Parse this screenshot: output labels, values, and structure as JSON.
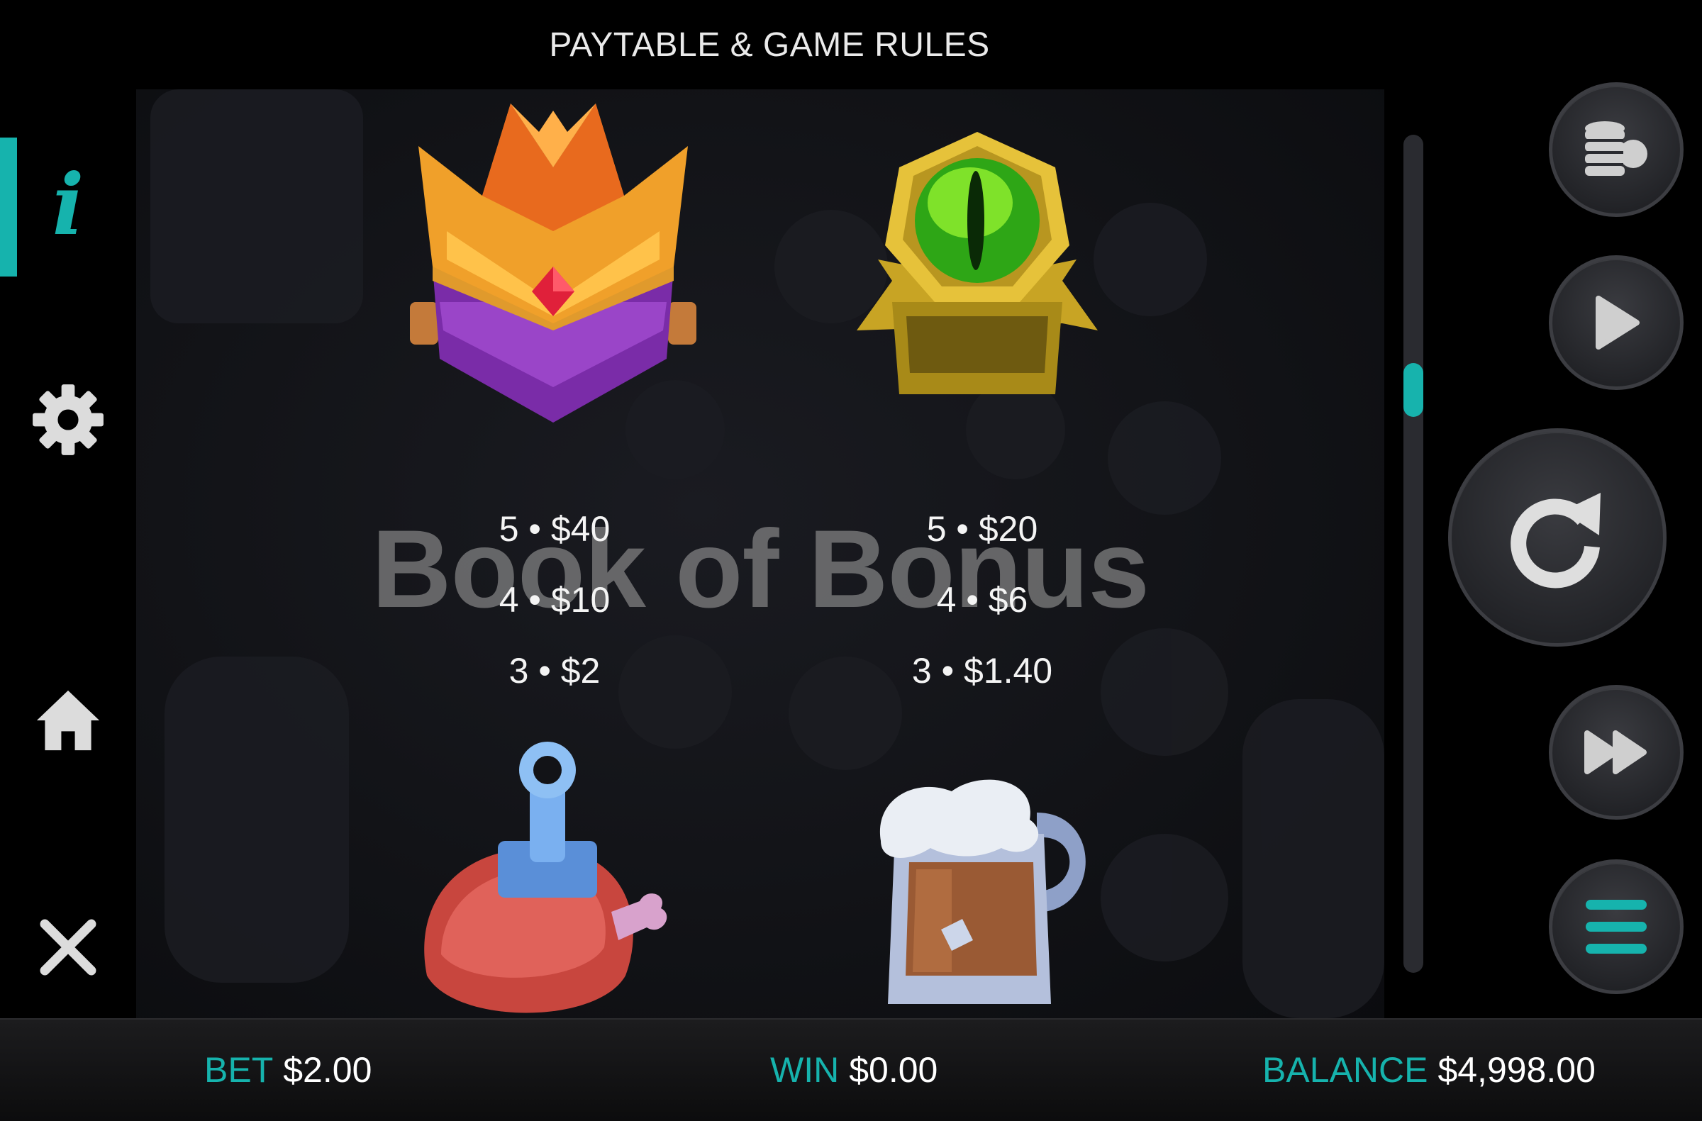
{
  "header": {
    "title": "PAYTABLE & GAME RULES"
  },
  "sidebar": {
    "items": [
      {
        "name": "info",
        "icon": "info-icon",
        "active": true
      },
      {
        "name": "settings",
        "icon": "gear-icon",
        "active": false
      },
      {
        "name": "home",
        "icon": "home-icon",
        "active": false
      },
      {
        "name": "close",
        "icon": "close-icon",
        "active": false
      }
    ]
  },
  "background": {
    "game_title": "Book of Bonus"
  },
  "paytable": {
    "symbols": [
      {
        "icon": "crown-symbol",
        "pays": [
          "5 • $40",
          "4 • $10",
          "3 • $2"
        ]
      },
      {
        "icon": "eye-ring-symbol",
        "pays": [
          "5 • $20",
          "4 • $6",
          "3 • $1.40"
        ]
      },
      {
        "icon": "meat-potion-symbol",
        "pays": []
      },
      {
        "icon": "ale-mug-symbol",
        "pays": []
      }
    ]
  },
  "controls": {
    "buttons": [
      "coins-icon",
      "play-icon",
      "spin-icon",
      "fast-forward-icon",
      "menu-icon"
    ]
  },
  "footer": {
    "bet_label": "BET",
    "bet_value": "$2.00",
    "win_label": "WIN",
    "win_value": "$0.00",
    "balance_label": "BALANCE",
    "balance_value": "$4,998.00"
  },
  "colors": {
    "accent": "#16b3ad",
    "background": "#000000",
    "panel": "#121317"
  }
}
